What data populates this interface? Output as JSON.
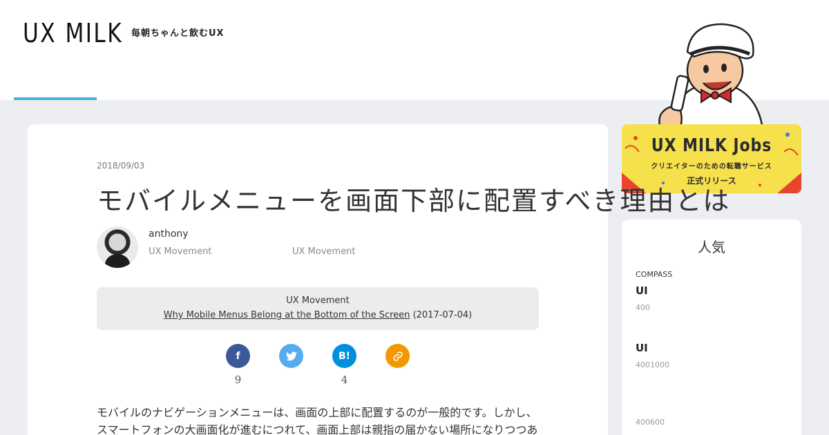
{
  "header": {
    "logo": "UX MILK",
    "tagline": "毎朝ちゃんと飲むUX"
  },
  "article": {
    "date": "2018/09/03",
    "title": "モバイルメニューを画面下部に配置すべき理由とは",
    "author_name": "anthony",
    "author_source_1": "UX Movement",
    "author_source_2": "UX Movement",
    "source_label": "UX Movement",
    "source_link_text": "Why Mobile Menus Belong at the Bottom of the Screen",
    "source_date": "(2017-07-04)",
    "share": {
      "facebook_icon": "f",
      "twitter_icon": "🐦",
      "hatena_icon": "B!",
      "link_icon": "🔗",
      "facebook_count": "9",
      "hatena_count": "4"
    },
    "body": "モバイルのナビゲーションメニューは、画面の上部に配置するのが一般的です。しかし、スマートフォンの大画面化が進むにつれて、画面上部は親指の届かない場所になりつつあります。"
  },
  "banner": {
    "title": "UX MILK Jobs",
    "subtitle": "クリエイターのための転職サービス",
    "release": "正式リリース"
  },
  "sidebar": {
    "title": "人気",
    "category": "COMPASS",
    "items": [
      {
        "title": "UI",
        "meta": "400"
      },
      {
        "title": "UI",
        "meta": "4001000"
      },
      {
        "title": "",
        "meta": "400600"
      }
    ]
  },
  "colors": {
    "accent": "#4ab0dc",
    "facebook": "#3b5998",
    "twitter": "#55acee",
    "hatena": "#008fde",
    "link": "#f39800",
    "banner": "#f6e04c"
  }
}
